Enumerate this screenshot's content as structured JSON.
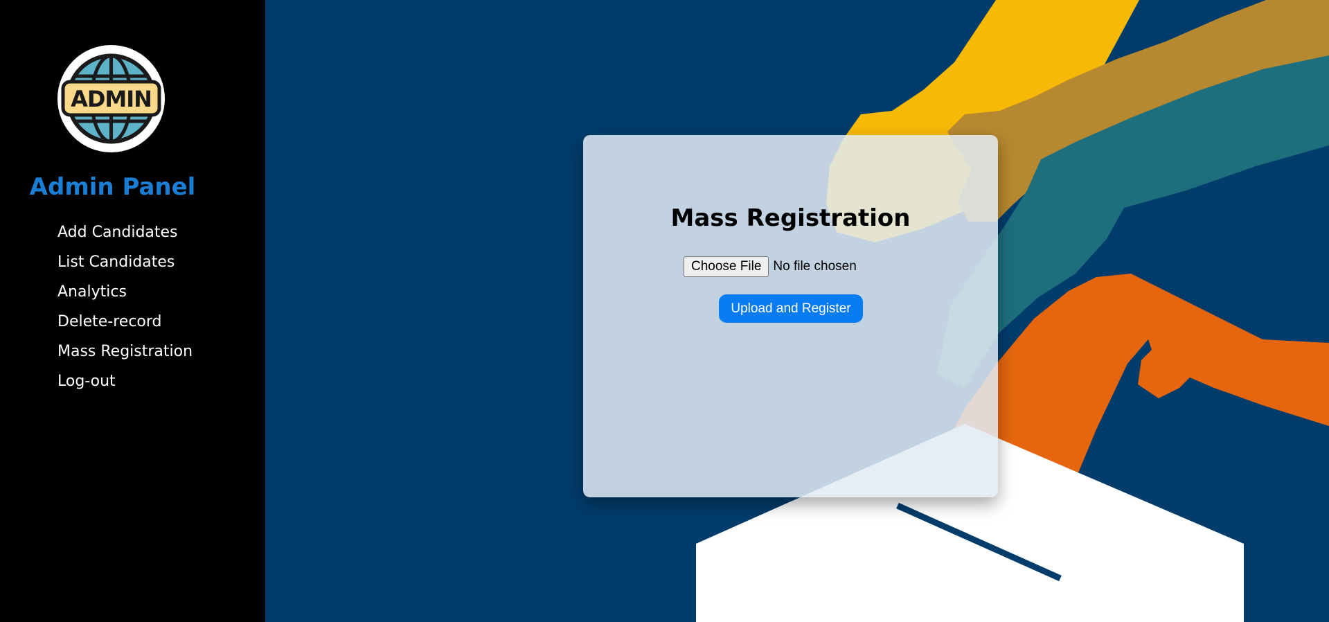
{
  "sidebar": {
    "logo_text": "ADMIN",
    "title": "Admin Panel",
    "nav": [
      {
        "label": "Add Candidates"
      },
      {
        "label": "List Candidates"
      },
      {
        "label": "Analytics"
      },
      {
        "label": "Delete-record"
      },
      {
        "label": "Mass Registration"
      },
      {
        "label": "Log-out"
      }
    ]
  },
  "main": {
    "heading": "Mass Registration",
    "file_input": {
      "button_label": "Choose File",
      "status_text": "No file chosen"
    },
    "submit_label": "Upload and Register"
  },
  "colors": {
    "sidebar_bg": "#000000",
    "panel_title": "#1a7fd4",
    "main_bg": "#013c6b",
    "primary_button": "#0a7cf2"
  }
}
